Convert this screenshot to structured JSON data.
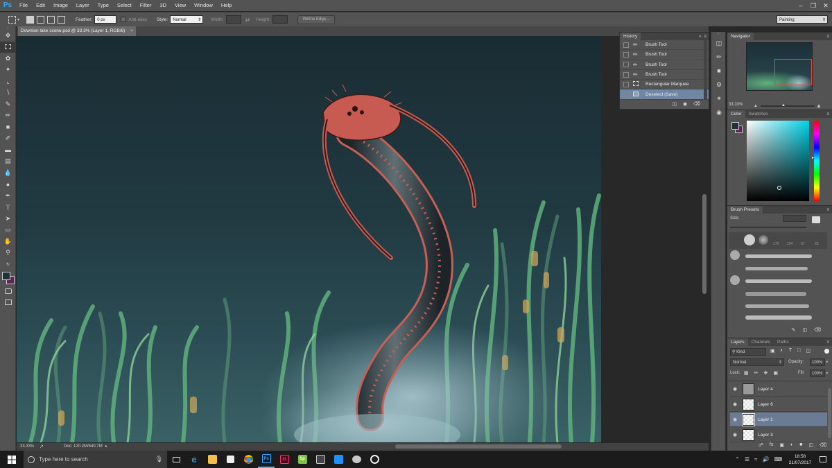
{
  "app": {
    "logo": "Ps"
  },
  "menu": [
    "File",
    "Edit",
    "Image",
    "Layer",
    "Type",
    "Select",
    "Filter",
    "3D",
    "View",
    "Window",
    "Help"
  ],
  "options": {
    "feather_label": "Feather:",
    "feather_value": "0 px",
    "antialias_label": "Anti-alias",
    "style_label": "Style:",
    "style_value": "Normal",
    "width_label": "Width:",
    "height_label": "Height:",
    "refine_edge": "Refine Edge...",
    "workspace": "Painting"
  },
  "document": {
    "tab_title": "Downton lake scene.psd @ 33.3% (Layer 1, RGB/8)",
    "zoom": "33.33%",
    "doc_size": "Doc: 120.2M/540.7M"
  },
  "history": {
    "title": "History",
    "items": [
      {
        "label": "Brush Tool",
        "icon": "brush-icon"
      },
      {
        "label": "Brush Tool",
        "icon": "brush-icon"
      },
      {
        "label": "Brush Tool",
        "icon": "brush-icon"
      },
      {
        "label": "Brush Tool",
        "icon": "brush-icon"
      },
      {
        "label": "Rectangular Marquee",
        "icon": "marquee-icon"
      },
      {
        "label": "Deselect (Save)",
        "icon": "deselect-icon",
        "selected": true
      }
    ]
  },
  "navigator": {
    "title": "Navigator",
    "zoom": "33.33%"
  },
  "color": {
    "tab_color": "Color",
    "tab_swatches": "Swatches",
    "foreground": "#1f3236",
    "background": "#6b1f5a",
    "hue_color": "#00d2e8"
  },
  "brush_presets": {
    "title": "Brush Presets",
    "size_label": "Size:",
    "sizes": [
      "179",
      "154",
      "67",
      "23"
    ]
  },
  "layers": {
    "tab_layers": "Layers",
    "tab_channels": "Channels",
    "tab_paths": "Paths",
    "filter_kind": "Kind",
    "blend_mode": "Normal",
    "opacity_label": "Opacity:",
    "opacity_value": "100%",
    "lock_label": "Lock:",
    "fill_label": "Fill:",
    "fill_value": "100%",
    "items": [
      {
        "name": "Layer 4",
        "selected": false
      },
      {
        "name": "Layer 6",
        "selected": false
      },
      {
        "name": "Layer 1",
        "selected": true
      },
      {
        "name": "Layer 3",
        "selected": false
      }
    ]
  },
  "taskbar": {
    "search_placeholder": "Type here to search",
    "time": "18:58",
    "date": "21/07/2017",
    "app_labels": [
      "Ps",
      "Id",
      "Sp"
    ]
  }
}
